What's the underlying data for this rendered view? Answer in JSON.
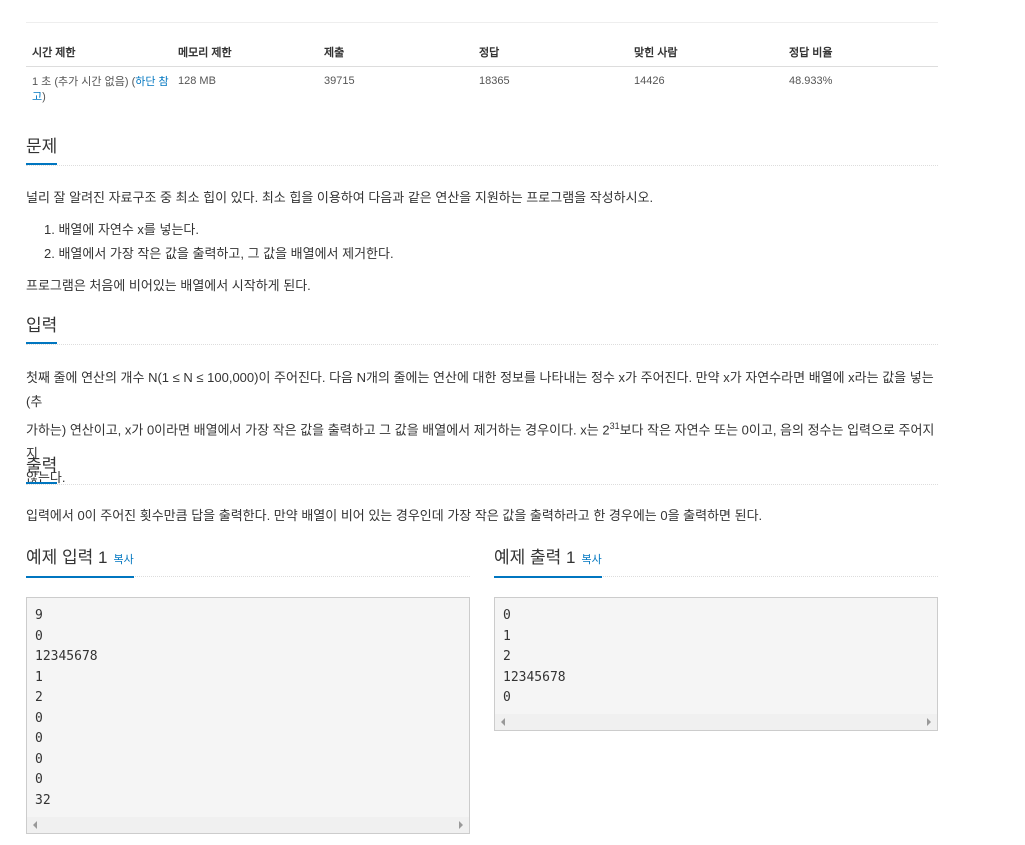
{
  "info_table": {
    "headers": [
      "시간 제한",
      "메모리 제한",
      "제출",
      "정답",
      "맞힌 사람",
      "정답 비율"
    ],
    "time_limit_prefix": "1 초 (추가 시간 없음) (",
    "time_limit_link": "하단 참고",
    "time_limit_suffix": ")",
    "memory_limit": "128 MB",
    "submissions": "39715",
    "accepted": "18365",
    "solvers": "14426",
    "ratio": "48.933%"
  },
  "problem": {
    "title": "문제",
    "intro": "널리 잘 알려진 자료구조 중 최소 힙이 있다. 최소 힙을 이용하여 다음과 같은 연산을 지원하는 프로그램을 작성하시오.",
    "ops": [
      "1. 배열에 자연수 x를 넣는다.",
      "2. 배열에서 가장 작은 값을 출력하고, 그 값을 배열에서 제거한다."
    ],
    "outro": "프로그램은 처음에 비어있는 배열에서 시작하게 된다."
  },
  "input": {
    "title": "입력",
    "line1": "첫째 줄에 연산의 개수 N(1 ≤ N ≤ 100,000)이 주어진다. 다음 N개의 줄에는 연산에 대한 정보를 나타내는 정수 x가 주어진다. 만약 x가 자연수라면 배열에 x라는 값을 넣는(추",
    "line2_before": "가하는) 연산이고, x가 0이라면 배열에서 가장 작은 값을 출력하고 그 값을 배열에서 제거하는 경우이다. x는 2",
    "line2_sup": "31",
    "line2_after": "보다 작은 자연수 또는 0이고, 음의 정수는 입력으로 주어지지",
    "line3": "않는다."
  },
  "output": {
    "title": "출력",
    "text": "입력에서 0이 주어진 횟수만큼 답을 출력한다. 만약 배열이 비어 있는 경우인데 가장 작은 값을 출력하라고 한 경우에는 0을 출력하면 된다."
  },
  "sample_input": {
    "title": "예제 입력 1",
    "copy": "복사",
    "lines": [
      "9",
      "0",
      "12345678",
      "1",
      "2",
      "0",
      "0",
      "0",
      "0",
      "32"
    ]
  },
  "sample_output": {
    "title": "예제 출력 1",
    "copy": "복사",
    "lines": [
      "0",
      "1",
      "2",
      "12345678",
      "0"
    ]
  }
}
